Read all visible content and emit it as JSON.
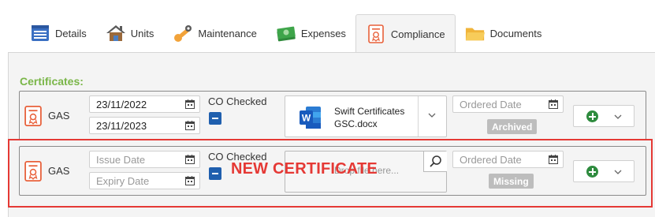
{
  "tabs": [
    {
      "label": "Details",
      "icon": "details-icon",
      "active": false
    },
    {
      "label": "Units",
      "icon": "house-icon",
      "active": false
    },
    {
      "label": "Maintenance",
      "icon": "wrench-icon",
      "active": false
    },
    {
      "label": "Expenses",
      "icon": "money-icon",
      "active": false
    },
    {
      "label": "Compliance",
      "icon": "certificate-icon",
      "active": true
    },
    {
      "label": "Documents",
      "icon": "folder-icon",
      "active": false
    }
  ],
  "section": {
    "title": "Certificates:"
  },
  "certificates": [
    {
      "type": "GAS",
      "issue_date": "23/11/2022",
      "expiry_date": "23/11/2023",
      "co_label": "CO Checked",
      "file_line1": "Swift Certificates",
      "file_line2": "GSC.docx",
      "ordered_placeholder": "Ordered Date",
      "status": "Archived"
    },
    {
      "type": "GAS",
      "issue_placeholder": "Issue Date",
      "expiry_placeholder": "Expiry Date",
      "co_label": "CO Checked",
      "drop_text": "Drop file here...",
      "ordered_placeholder": "Ordered Date",
      "status": "Missing"
    }
  ],
  "annotation": "NEW CERTIFICATE",
  "colors": {
    "accent_green": "#7ab648",
    "check_blue": "#1f5fae",
    "add_green": "#2e8b3e",
    "annotation_red": "#e53935",
    "badge_grey": "#bdbdbd"
  }
}
